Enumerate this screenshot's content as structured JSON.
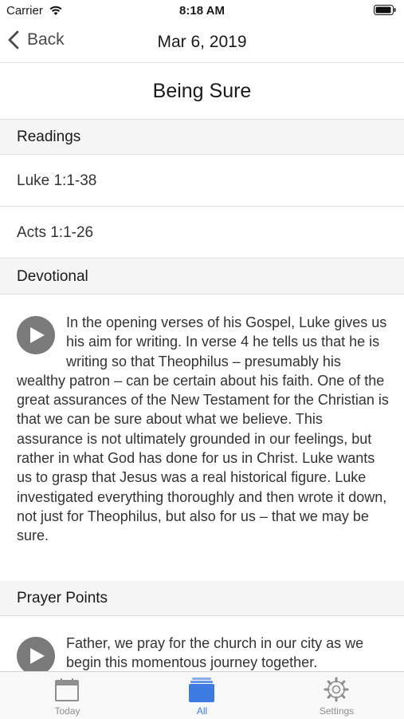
{
  "status_bar": {
    "carrier": "Carrier",
    "time": "8:18 AM"
  },
  "nav": {
    "back_label": "Back",
    "title": "Mar 6, 2019"
  },
  "page": {
    "title": "Being Sure"
  },
  "readings": {
    "header": "Readings",
    "items": [
      "Luke 1:1-38",
      "Acts 1:1-26"
    ]
  },
  "devotional": {
    "header": "Devotional",
    "text": "In the opening verses of his Gospel, Luke gives us his aim for writing. In verse 4 he tells us that he is writing so that Theophilus – presumably his wealthy patron – can be certain about his faith. One of the great assurances of the New Testament for the Christian is that we can be sure about what we believe. This assurance is not ultimately grounded in our feelings, but rather in what God has done for us in Christ. Luke wants us to grasp that Jesus was a real historical figure. Luke investigated everything thoroughly and then wrote it down, not just for Theophilus, but also for us – that we may be sure."
  },
  "prayer_points": {
    "header": "Prayer Points",
    "text": "Father, we pray for the church in our city as we begin this momentous journey together."
  },
  "tabs": [
    {
      "label": "Today",
      "icon": "calendar-icon",
      "active": false
    },
    {
      "label": "All",
      "icon": "stack-icon",
      "active": true
    },
    {
      "label": "Settings",
      "icon": "gear-icon",
      "active": false
    }
  ],
  "colors": {
    "accent": "#3d7be0",
    "play_button": "#7a7a7a",
    "section_bg": "#f5f5f5"
  }
}
